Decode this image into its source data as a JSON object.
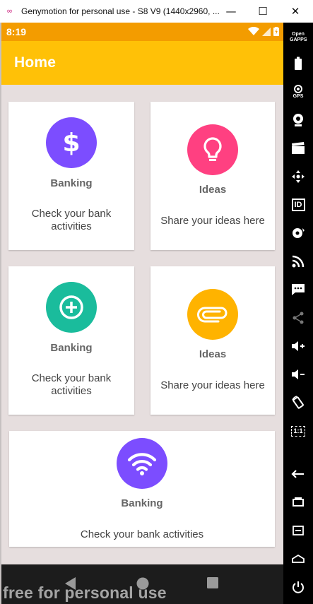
{
  "window": {
    "logo": "∞",
    "title": "Genymotion for personal use - S8 V9 (1440x2960, ...",
    "minimize": "—",
    "maximize": "☐",
    "close": "✕"
  },
  "statusbar": {
    "time": "8:19"
  },
  "appbar": {
    "title": "Home"
  },
  "cards": [
    {
      "title": "Banking",
      "desc": "Check your bank activities",
      "icon": "dollar-icon",
      "color": "#7c4dff"
    },
    {
      "title": "Ideas",
      "desc": "Share your ideas here",
      "icon": "lightbulb-icon",
      "color": "#ff4081"
    },
    {
      "title": "Banking",
      "desc": "Check your bank activities",
      "icon": "plus-circle-icon",
      "color": "#1abc9c"
    },
    {
      "title": "Ideas",
      "desc": "Share your ideas here",
      "icon": "paperclip-icon",
      "color": "#ffb300"
    },
    {
      "title": "Banking",
      "desc": "Check your bank activities",
      "icon": "wifi-icon",
      "color": "#7c4dff"
    }
  ],
  "watermark": "free for personal use",
  "sidebar": {
    "gapps_label": "Open GAPPS",
    "gps_label": "GPS",
    "id_label": "ID",
    "scale_label": "1:1"
  }
}
